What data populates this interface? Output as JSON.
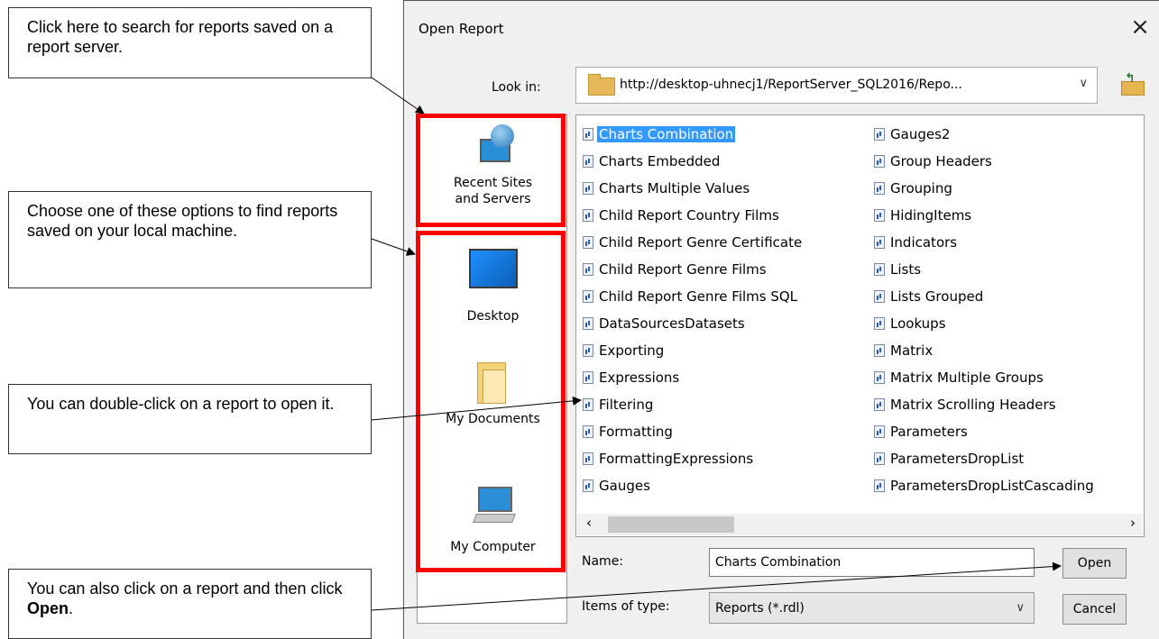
{
  "callouts": {
    "search_server": "Click here to search for reports saved on a report server.",
    "local_machine": "Choose one of these options to find reports saved on your local machine.",
    "double_click": "You can double-click on a report to open it.",
    "click_open_prefix": "You can also click on a report and then click ",
    "click_open_bold": "Open",
    "click_open_suffix": "."
  },
  "dialog": {
    "title": "Open Report",
    "close_icon": "×",
    "look_in_label": "Look in:",
    "look_in_value": "http://desktop-uhnecj1/ReportServer_SQL2016/Repo...",
    "places": [
      {
        "label": "Recent Sites and Servers",
        "icon": "globe-monitor-icon"
      },
      {
        "label": "Desktop",
        "icon": "desktop-icon"
      },
      {
        "label": "My Documents",
        "icon": "documents-folder-icon"
      },
      {
        "label": "My Computer",
        "icon": "computer-icon"
      }
    ],
    "files_col1": [
      "Charts Combination",
      "Charts Embedded",
      "Charts Multiple Values",
      "Child Report Country Films",
      "Child Report Genre Certificate",
      "Child Report Genre Films",
      "Child Report Genre Films SQL",
      "DataSourcesDatasets",
      "Exporting",
      "Expressions",
      "Filtering",
      "Formatting",
      "FormattingExpressions",
      "Gauges"
    ],
    "files_col2": [
      "Gauges2",
      "Group Headers",
      "Grouping",
      "HidingItems",
      "Indicators",
      "Lists",
      "Lists Grouped",
      "Lookups",
      "Matrix",
      "Matrix Multiple Groups",
      "Matrix Scrolling Headers",
      "Parameters",
      "ParametersDropList",
      "ParametersDropListCascading"
    ],
    "selected_file": "Charts Combination",
    "name_label": "Name:",
    "name_value": "Charts Combination",
    "open_button": "Open",
    "types_label": "Items of type:",
    "types_value": "Reports (*.rdl)",
    "cancel_button": "Cancel"
  },
  "colors": {
    "highlight": "#ff0000",
    "selection": "#3399ff"
  }
}
